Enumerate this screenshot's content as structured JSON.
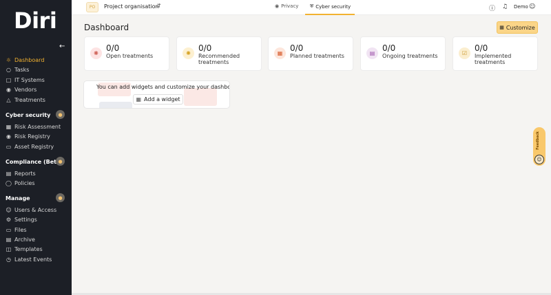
{
  "sidebar": {
    "logo": "Diri",
    "collapse_icon": "arrow-left-icon",
    "nav": [
      {
        "label": "Dashboard",
        "icon": "dashboard-icon",
        "active": true
      },
      {
        "label": "Tasks",
        "icon": "tasks-icon"
      },
      {
        "label": "IT Systems",
        "icon": "server-icon"
      },
      {
        "label": "Vendors",
        "icon": "globe-icon"
      },
      {
        "label": "Treatments",
        "icon": "treatments-icon"
      }
    ],
    "sections": [
      {
        "title": "Cyber security",
        "items": [
          "Risk Assessment",
          "Risk Registry",
          "Asset Registry"
        ]
      },
      {
        "title": "Compliance (Beta)",
        "items": [
          "Reports",
          "Policies"
        ]
      },
      {
        "title": "Manage",
        "items": [
          "Users & Access",
          "Settings",
          "Files",
          "Archive",
          "Templates",
          "Latest Events"
        ]
      }
    ]
  },
  "topbar": {
    "org_initials": "PO",
    "org_name": "Project organisation",
    "tabs": [
      {
        "label": "Privacy",
        "icon": "eye-icon"
      },
      {
        "label": "Cyber security",
        "icon": "shield-icon",
        "active": true
      }
    ],
    "user": "Demo"
  },
  "main": {
    "title": "Dashboard",
    "customize_label": "Customize",
    "cards": [
      {
        "value": "0/0",
        "label": "Open treatments",
        "icon_bg": "#fde3e3",
        "icon_color": "#c0392b"
      },
      {
        "value": "0/0",
        "label": "Recommended treatments",
        "icon_bg": "#fdf0d0",
        "icon_color": "#d39e1a"
      },
      {
        "value": "0/0",
        "label": "Planned treatments",
        "icon_bg": "#fde6dc",
        "icon_color": "#d65a2b"
      },
      {
        "value": "0/0",
        "label": "Ongoing treatments",
        "icon_bg": "#f1e4f3",
        "icon_color": "#9b4fa8"
      },
      {
        "value": "0/0",
        "label": "Implemented treatments",
        "icon_bg": "#fbeecf",
        "icon_color": "#c9962a"
      }
    ],
    "widget_hint": "You can add widgets and customize your dashboard",
    "add_widget_label": "Add a widget"
  },
  "feedback_label": "Feedback",
  "colors": {
    "accent": "#f2b230",
    "sidebar_bg": "#1c1f26"
  }
}
